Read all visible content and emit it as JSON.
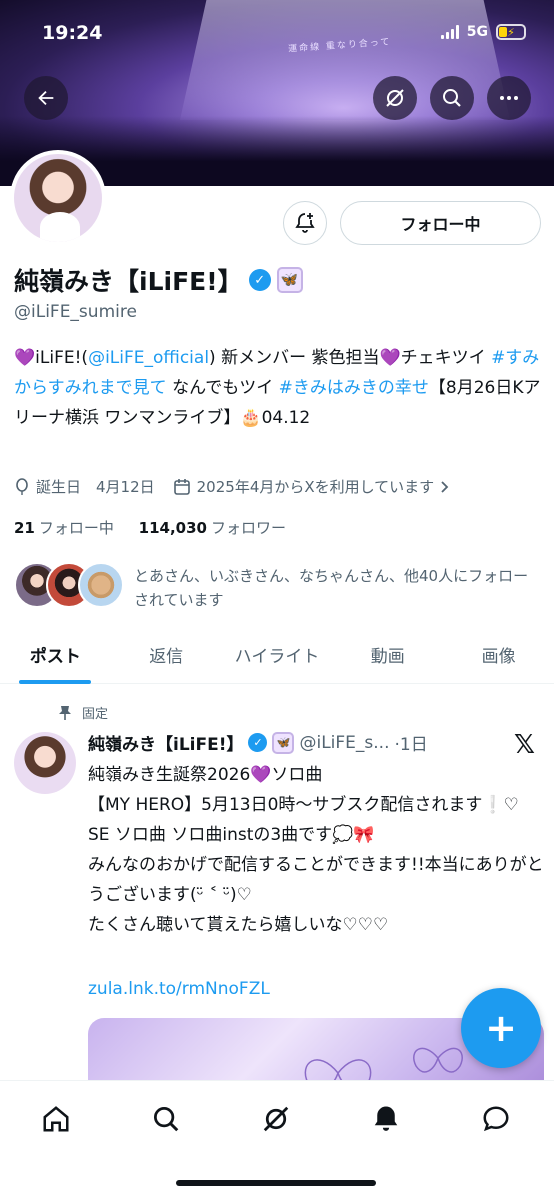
{
  "status_bar": {
    "time": "19:24",
    "network": "5G"
  },
  "banner": {
    "caption": "運命線 重なり合って"
  },
  "header_actions": {
    "back": "back-arrow-icon",
    "grok": "slash-circle-icon",
    "search": "search-icon",
    "more": "more-icon"
  },
  "profile": {
    "follow_button": "フォロー中",
    "name": "純嶺みき【iLiFE!】",
    "handle": "@iLiFE_sumire",
    "bio": {
      "p1": "💜iLiFE!(",
      "mention": "@iLiFE_official",
      "p2": ") 新メンバー 紫色担当💜チェキツイ ",
      "tag1": "#すみからすみれまで見て",
      "p3": " なんでもツイ ",
      "tag2": "#きみはみきの幸せ",
      "p4": "【8月26日Kアリーナ横浜 ワンマンライブ】🎂04.12"
    },
    "birthday": "誕生日　4月12日",
    "joined": "2025年4月からXを利用しています",
    "following_count": "21",
    "following_label": "フォロー中",
    "followers_count": "114,030",
    "followers_label": "フォロワー",
    "followed_by": "とあさん、いぶきさん、なちゃんさん、他40人にフォローされています"
  },
  "tabs": [
    {
      "label": "ポスト"
    },
    {
      "label": "返信"
    },
    {
      "label": "ハイライト"
    },
    {
      "label": "動画"
    },
    {
      "label": "画像"
    }
  ],
  "post": {
    "pinned": "固定",
    "author": "純嶺みき【iLiFE!】",
    "handle": "@iLiFE_s...",
    "time": "·1日",
    "lines": [
      "純嶺みき生誕祭2026💜ソロ曲",
      "【MY HERO】5月13日0時〜サブスク配信されます❕♡",
      "SE ソロ曲 ソロ曲instの3曲です💭🎀",
      "みんなのおかげで配信することができます!!本当にありがとうございます(ᵕ̈ ˂ ᵕ̈)♡",
      "たくさん聴いて貰えたら嬉しいな♡♡♡"
    ],
    "link": "zula.lnk.to/rmNnoFZL"
  },
  "fab": "+",
  "bottom_nav": [
    "home-icon",
    "search-icon",
    "grok-icon",
    "notifications-icon",
    "messages-icon"
  ]
}
